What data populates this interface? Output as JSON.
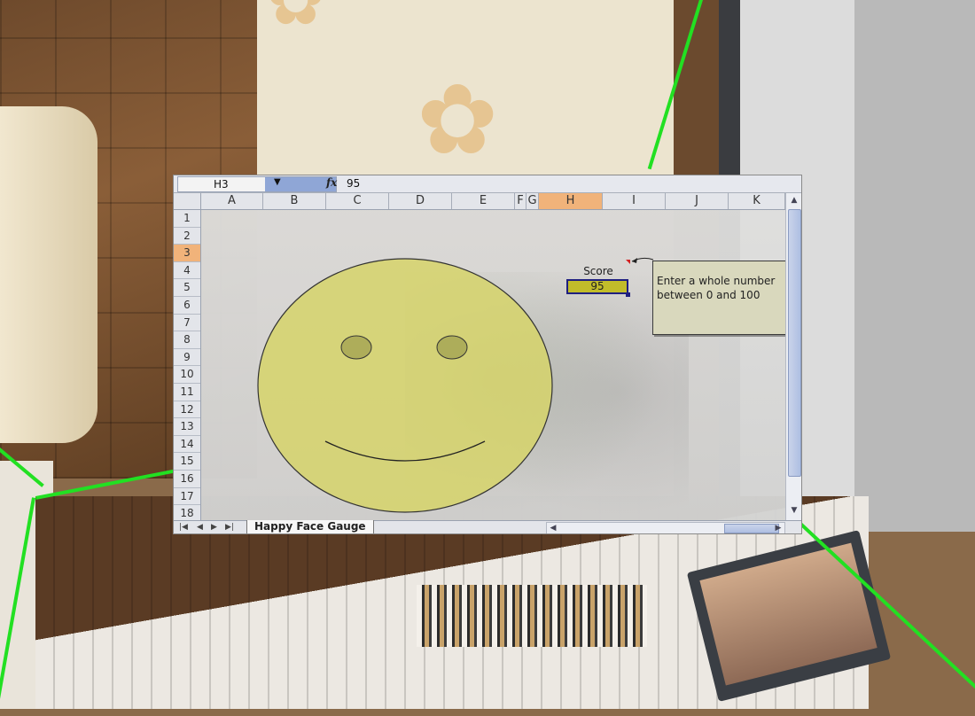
{
  "formula_bar": {
    "name_box": "H3",
    "name_box_arrow_icon": "dropdown-arrow",
    "fx_icon": "fx",
    "formula_value": "95"
  },
  "columns": [
    "A",
    "B",
    "C",
    "D",
    "E",
    "F",
    "G",
    "H",
    "I",
    "J",
    "K"
  ],
  "active_column": "H",
  "rows": [
    "1",
    "2",
    "3",
    "4",
    "5",
    "6",
    "7",
    "8",
    "9",
    "10",
    "11",
    "12",
    "13",
    "14",
    "15",
    "16",
    "17",
    "18"
  ],
  "active_row": "3",
  "score": {
    "label": "Score",
    "value": "95"
  },
  "comment": {
    "text": "Enter a whole number between 0 and 100"
  },
  "gauge": {
    "face_color": "#d6d46a",
    "type": "happy-face"
  },
  "sheet_tabs": [
    {
      "label": "Happy Face Gauge",
      "active": true
    }
  ],
  "colors": {
    "highlight_header": "#f1b37a",
    "score_cell_fill": "#c1bc2a",
    "selection_border": "#1f1f80",
    "frame_edge": "#22e022"
  }
}
